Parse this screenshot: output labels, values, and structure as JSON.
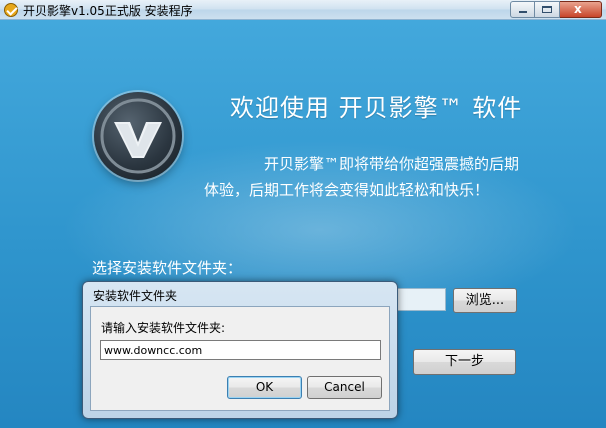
{
  "window": {
    "title": "开贝影擎v1.05正式版 安装程序",
    "icon": "app-check-icon",
    "close_glyph": "x"
  },
  "main": {
    "headline": "欢迎使用 开贝影擎™ 软件",
    "description_line1": "开贝影擎™即将带给你超强震撼的后期",
    "description_line2": "体验，后期工作将会变得如此轻松和快乐！",
    "folder_label": "选择安装软件文件夹：",
    "browse_label": "浏览...",
    "next_label": "下一步",
    "logo": "v-logo-icon"
  },
  "dialog": {
    "title": "安装软件文件夹",
    "prompt": "请输入安装软件文件夹:",
    "input_value": "www.downcc.com",
    "ok_label": "OK",
    "cancel_label": "Cancel"
  },
  "colors": {
    "background": "#2f95cd",
    "accent": "#43a8dc",
    "text_light": "#ffffff"
  }
}
